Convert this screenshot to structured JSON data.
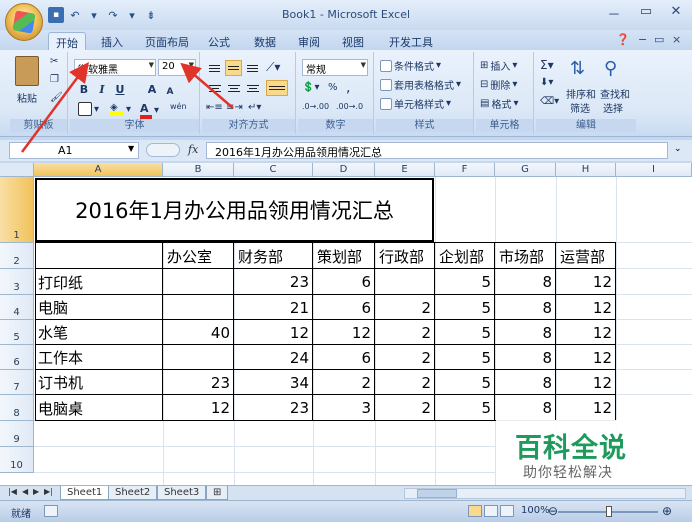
{
  "window": {
    "title": "Book1 - Microsoft Excel",
    "minimize": "－",
    "restore": "▭",
    "close": "✕"
  },
  "tabs": [
    "开始",
    "插入",
    "页面布局",
    "公式",
    "数据",
    "审阅",
    "视图",
    "开发工具"
  ],
  "ribbon": {
    "clipboard": {
      "paste": "粘贴",
      "label": "剪贴板"
    },
    "font": {
      "name": "微软雅黑",
      "size": "20",
      "label": "字体",
      "bold": "B",
      "italic": "I",
      "underline": "U",
      "grow": "A",
      "shrink": "A"
    },
    "alignment": {
      "label": "对齐方式"
    },
    "number": {
      "format": "常规",
      "percent": "%",
      "comma": ",",
      "label": "数字"
    },
    "styles": {
      "conditional": "条件格式",
      "table": "套用表格格式",
      "cell": "单元格样式",
      "label": "样式"
    },
    "cells": {
      "insert": "插入",
      "delete": "删除",
      "format": "格式",
      "label": "单元格"
    },
    "editing": {
      "sort": "排序和",
      "filter": "筛选",
      "find": "查找和",
      "select": "选择",
      "label": "编辑"
    }
  },
  "formula_bar": {
    "name_box": "A1",
    "fx": "fx",
    "formula": "2016年1月办公用品领用情况汇总"
  },
  "sheet": {
    "columns": [
      "A",
      "B",
      "C",
      "D",
      "E",
      "F",
      "G",
      "H",
      "I"
    ],
    "rows": [
      "1",
      "2",
      "3",
      "4",
      "5",
      "6",
      "7",
      "8",
      "9",
      "10"
    ],
    "title": "2016年1月办公用品领用情况汇总",
    "headers": [
      "办公室",
      "财务部",
      "策划部",
      "行政部",
      "企划部",
      "市场部",
      "运营部"
    ],
    "data": [
      {
        "item": "打印纸",
        "values": [
          "",
          "23",
          "6",
          "",
          "5",
          "8",
          "12"
        ]
      },
      {
        "item": "电脑",
        "values": [
          "",
          "21",
          "6",
          "2",
          "5",
          "8",
          "12"
        ]
      },
      {
        "item": "水笔",
        "values": [
          "40",
          "12",
          "12",
          "2",
          "5",
          "8",
          "12"
        ]
      },
      {
        "item": "工作本",
        "values": [
          "",
          "24",
          "6",
          "2",
          "5",
          "8",
          "12"
        ]
      },
      {
        "item": "订书机",
        "values": [
          "23",
          "34",
          "2",
          "2",
          "5",
          "8",
          "12"
        ]
      },
      {
        "item": "电脑桌",
        "values": [
          "12",
          "23",
          "3",
          "2",
          "5",
          "8",
          "12"
        ]
      }
    ]
  },
  "sheet_tabs": [
    "Sheet1",
    "Sheet2",
    "Sheet3"
  ],
  "status": {
    "ready": "就绪",
    "zoom": "100%"
  },
  "watermark": {
    "title": "百科全说",
    "subtitle": "助你轻松解决"
  },
  "colors": {
    "annotation_arrow": "#e0342a",
    "watermark_green": "#1e9b5c"
  }
}
